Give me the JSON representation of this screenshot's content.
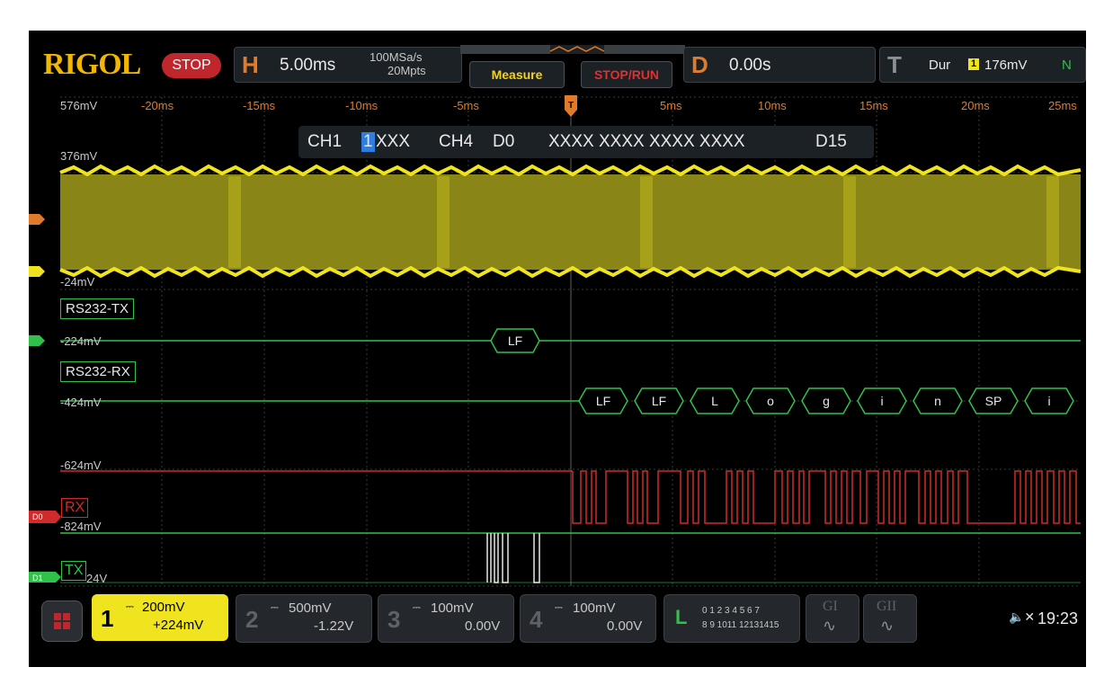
{
  "brand": "RIGOL",
  "run_state": "STOP",
  "horizontal": {
    "letter": "H",
    "timebase": "5.00ms",
    "sample_rate": "100MSa/s",
    "memory_depth": "20Mpts"
  },
  "buttons": {
    "measure": "Measure",
    "stop_run": "STOP/RUN"
  },
  "delay": {
    "letter": "D",
    "value": "0.00s"
  },
  "trigger": {
    "letter": "T",
    "type": "Dur",
    "channel": "1",
    "level": "176mV",
    "mode": "N"
  },
  "time_axis": [
    "-20ms",
    "-15ms",
    "-10ms",
    "-5ms",
    "5ms",
    "10ms",
    "15ms",
    "20ms",
    "25ms"
  ],
  "voltage_labels": {
    "v576": "576mV",
    "v376": "376mV",
    "vm24": "-24mV",
    "vm224": "-224mV",
    "vm424": "-424mV",
    "vm624": "-624mV",
    "vm824": "-824mV",
    "vm1024": "24V"
  },
  "bus_info": {
    "ch1": "CH1",
    "highlight": "1",
    "rest": "XXX",
    "ch4": "CH4",
    "d0": "D0",
    "pattern": "XXXX XXXX XXXX XXXX",
    "d15": "D15"
  },
  "buses": {
    "tx": "RS232-TX",
    "rx": "RS232-RX"
  },
  "tx_frames": [
    "LF"
  ],
  "rx_frames": [
    "LF",
    "LF",
    "L",
    "o",
    "g",
    "i",
    "n",
    "SP",
    "i"
  ],
  "digital_labels": {
    "rx": "RX",
    "tx": "TX",
    "d0": "D0",
    "d1": "D1"
  },
  "channels": [
    {
      "num": "1",
      "scale": "200mV",
      "offset": "+224mV"
    },
    {
      "num": "2",
      "scale": "500mV",
      "offset": "-1.22V"
    },
    {
      "num": "3",
      "scale": "100mV",
      "offset": "0.00V"
    },
    {
      "num": "4",
      "scale": "100mV",
      "offset": "0.00V"
    }
  ],
  "la": {
    "letter": "L",
    "row1": "0 1 2 3  4 5 6 7",
    "row2": "8 9 1011 12131415"
  },
  "gen": {
    "g1": "GI",
    "g2": "GII"
  },
  "clock": "19:23",
  "colors": {
    "ch1": "#f0e41f",
    "ch4_bus": "#2fc14a",
    "digital_rx": "#d12a2a",
    "trigger": "#e07b2a",
    "brand": "#f2b705"
  }
}
